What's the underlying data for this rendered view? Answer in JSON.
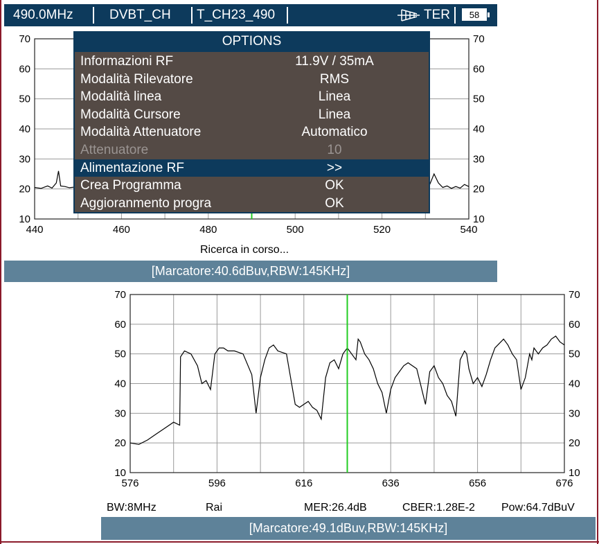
{
  "top_screen": {
    "header": {
      "frequency": "490.0MHz",
      "standard": "DVBT_CH",
      "channel": "T_CH23_490",
      "antenna_icon": "antenna-icon",
      "band": "TER",
      "battery": "58"
    },
    "options": {
      "title": "OPTIONS",
      "items": [
        {
          "label": "Informazioni RF",
          "value": "11.9V / 35mA",
          "state": "normal"
        },
        {
          "label": "Modalità Rilevatore",
          "value": "RMS",
          "state": "normal"
        },
        {
          "label": "Modalità linea",
          "value": "Linea",
          "state": "normal"
        },
        {
          "label": "Modalità Cursore",
          "value": "Linea",
          "state": "normal"
        },
        {
          "label": "Modalità Attenuatore",
          "value": "Automatico",
          "state": "normal"
        },
        {
          "label": "Attenuatore",
          "value": "10",
          "state": "disabled"
        },
        {
          "label": "Alimentazione RF",
          "value": ">>",
          "state": "selected"
        },
        {
          "label": "Crea Programma",
          "value": "OK",
          "state": "normal"
        },
        {
          "label": "Aggioranmento progra",
          "value": "OK",
          "state": "normal"
        }
      ]
    },
    "status_text": "Ricerca in corso...",
    "marker_bar": "[Marcatore:40.6dBuv,RBW:145KHz]"
  },
  "bottom_screen": {
    "info": {
      "bw": "BW:8MHz",
      "name": "Rai",
      "mer": "MER:26.4dB",
      "cber": "CBER:1.28E-2",
      "pow": "Pow:64.7dBuV"
    },
    "marker_bar": "[Marcatore:49.1dBuv,RBW:145KHz]"
  },
  "colors": {
    "header_bg": "#0d3a5c",
    "status_bar_bg": "#5e8299",
    "menu_bg": "#544a45",
    "marker_line": "#22cc22",
    "frame": "#8b1a2a"
  },
  "chart_data": [
    {
      "type": "line",
      "x_ticks": [
        440,
        460,
        480,
        500,
        520,
        540
      ],
      "y_ticks": [
        10,
        20,
        30,
        40,
        50,
        60,
        70
      ],
      "xlim": [
        440,
        540
      ],
      "ylim": [
        10,
        70
      ],
      "marker_x": 490,
      "grid": true,
      "x": [
        440,
        441.5,
        443,
        444,
        445,
        445.5,
        446,
        447,
        448,
        449,
        450,
        530,
        531,
        532,
        533,
        534,
        535,
        536,
        537,
        538,
        539,
        540
      ],
      "y": [
        20.5,
        20.2,
        21,
        20.3,
        22,
        26,
        21,
        20.8,
        20.4,
        20.6,
        20.5,
        21,
        21.5,
        25,
        22,
        20.5,
        21,
        20.2,
        20.8,
        20.3,
        21.5,
        20.8
      ]
    },
    {
      "type": "line",
      "x_ticks": [
        576,
        596,
        616,
        636,
        656,
        676
      ],
      "y_ticks": [
        10,
        20,
        30,
        40,
        50,
        60,
        70
      ],
      "xlim": [
        576,
        676
      ],
      "ylim": [
        10,
        70
      ],
      "marker_x": 626,
      "grid": true,
      "x": [
        576,
        578,
        580,
        582,
        584,
        586,
        587.4,
        587.6,
        588.5,
        590,
        591.5,
        592.5,
        593.5,
        594.5,
        595.5,
        596.5,
        597.5,
        598.5,
        600,
        602,
        604,
        605,
        606,
        607,
        608,
        609,
        610,
        612,
        614,
        615,
        616,
        617,
        618,
        619,
        620,
        621,
        622,
        623,
        624,
        625,
        626,
        627,
        628,
        628.5,
        629,
        630,
        631,
        632,
        633,
        634,
        635,
        636,
        637,
        638,
        639,
        640,
        642,
        644,
        645,
        646,
        647,
        648,
        649,
        650,
        651,
        652,
        653,
        653.5,
        654,
        655,
        656,
        657,
        658,
        659,
        660,
        662,
        663,
        664,
        665,
        666,
        667,
        668,
        668.5,
        669,
        670,
        671,
        672,
        673,
        674,
        675,
        676
      ],
      "y": [
        20,
        19.5,
        21,
        23,
        25,
        27,
        26,
        49,
        51,
        50,
        46,
        40,
        41,
        38,
        50,
        52,
        52,
        51,
        51,
        50,
        43,
        30,
        42,
        48,
        52,
        53,
        51,
        50,
        33,
        32,
        33,
        34,
        32,
        31,
        28,
        42,
        47,
        48,
        45,
        50,
        52,
        50,
        48,
        55,
        54,
        50,
        48,
        45,
        40,
        37,
        30,
        38,
        42,
        44,
        46,
        47,
        45,
        33,
        44,
        46,
        42,
        40,
        36,
        34,
        29,
        48,
        51,
        50,
        45,
        40,
        42,
        39,
        43,
        48,
        52,
        55,
        53,
        50,
        48,
        38,
        42,
        50,
        48,
        52,
        50,
        52,
        53,
        55,
        56,
        54,
        53
      ]
    }
  ]
}
